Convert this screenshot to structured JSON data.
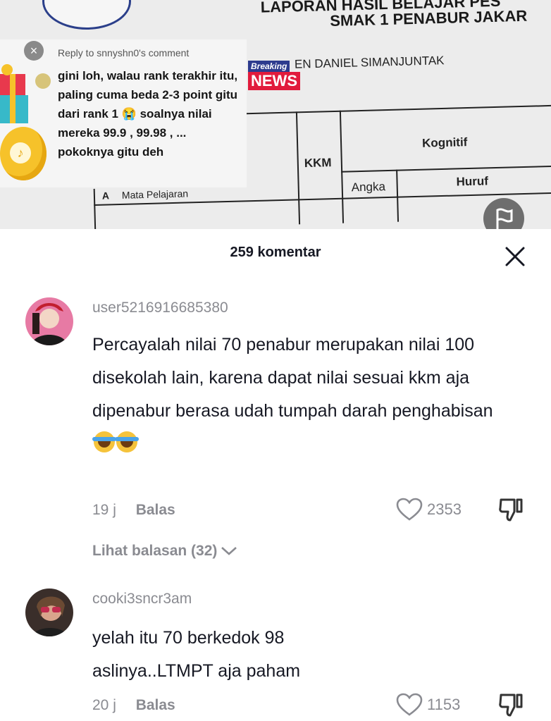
{
  "video": {
    "doc_header_line1": "LAPORAN HASIL BELAJAR PES",
    "doc_header_line2": "SMAK 1 PENABUR JAKAR",
    "doc_student_name": "EN DANIEL SIMANJUNTAK",
    "breaking_top": "Breaking",
    "breaking_bottom": "NEWS",
    "table_kkm": "KKM",
    "table_kognitif": "Kognitif",
    "table_angka": "Angka",
    "table_huruf": "Huruf",
    "table_mapel": "Mata Pelajaran",
    "table_col_a": "A",
    "reply_to": "Reply to snnyshn0's comment",
    "reply_text": "gini loh, walau rank terakhir itu, paling cuma beda 2-3 point gitu dari rank 1 😭 soalnya nilai mereka 99.9 , 99.98 , ... pokoknya gitu deh"
  },
  "comments_sheet": {
    "title": "259 komentar",
    "comments": [
      {
        "username": "user5216916685380",
        "text": "Percayalah nilai 70 penabur merupakan nilai 100 disekolah lain, karena dapat nilai sesuai kkm aja dipenabur berasa udah tumpah darah penghabisan",
        "time": "19 j",
        "reply_label": "Balas",
        "likes": "2353",
        "view_replies": "Lihat balasan (32)"
      },
      {
        "username": "cooki3sncr3am",
        "text": "yelah itu 70 berkedok 98 aslinya..LTMPT aja paham",
        "time": "20 j",
        "reply_label": "Balas",
        "likes": "1153"
      }
    ]
  },
  "colors": {
    "text_primary": "#161823",
    "text_secondary": "#8a8b91",
    "breaking_blue": "#2d3b8e",
    "breaking_red": "#e11b3c"
  }
}
